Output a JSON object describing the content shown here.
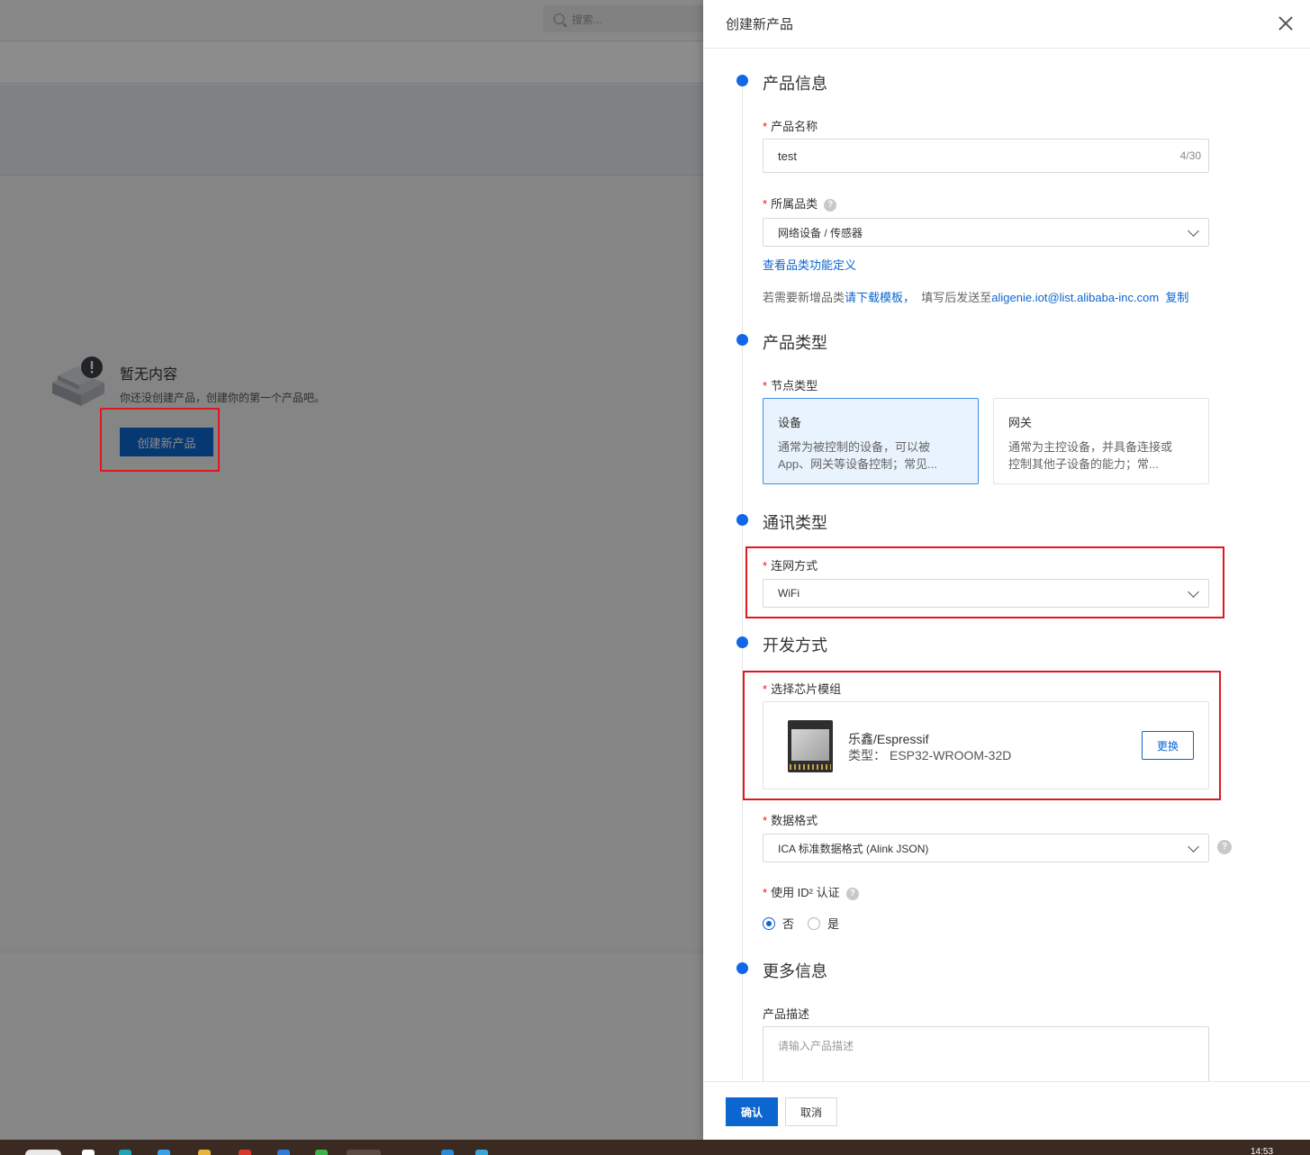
{
  "background": {
    "search_placeholder": "搜索...",
    "empty_title": "暂无内容",
    "empty_desc": "你还没创建产品，创建你的第一个产品吧。",
    "create_button": "创建新产品"
  },
  "drawer": {
    "title": "创建新产品",
    "sections": {
      "product_info": "产品信息",
      "product_type": "产品类型",
      "comm_type": "通讯类型",
      "dev_mode": "开发方式",
      "more_info": "更多信息"
    },
    "product_name": {
      "label": "产品名称",
      "value": "test",
      "counter": "4/30"
    },
    "category": {
      "label": "所属品类",
      "value": "网络设备 / 传感器",
      "view_link": "查看品类功能定义",
      "hint_prefix": "若需要新增品类",
      "hint_download": "请下载模板，",
      "hint_mid": "填写后发送至",
      "hint_email": "aligenie.iot@list.alibaba-inc.com",
      "hint_copy": "复制"
    },
    "node_type": {
      "label": "节点类型",
      "options": [
        {
          "title": "设备",
          "desc_line1": "通常为被控制的设备，可以被",
          "desc_line2": "App、网关等设备控制；常见..."
        },
        {
          "title": "网关",
          "desc_line1": "通常为主控设备，并具备连接或",
          "desc_line2": "控制其他子设备的能力；常..."
        }
      ]
    },
    "network": {
      "label": "连网方式",
      "value": "WiFi"
    },
    "chip": {
      "label": "选择芯片模组",
      "vendor": "乐鑫/Espressif",
      "model_prefix": "类型：",
      "model": "ESP32-WROOM-32D",
      "swap": "更换"
    },
    "data_format": {
      "label": "数据格式",
      "value": "ICA 标准数据格式 (Alink JSON)"
    },
    "id2": {
      "label": "使用 ID² 认证",
      "options": [
        "否",
        "是"
      ],
      "selected": "否"
    },
    "description": {
      "label": "产品描述",
      "placeholder": "请输入产品描述"
    },
    "confirm": "确认",
    "cancel": "取消"
  },
  "taskbar": {
    "clock": "14:53"
  },
  "colors": {
    "accent": "#0b66d0",
    "highlight": "#e1171f",
    "dot": "#1167e8"
  }
}
